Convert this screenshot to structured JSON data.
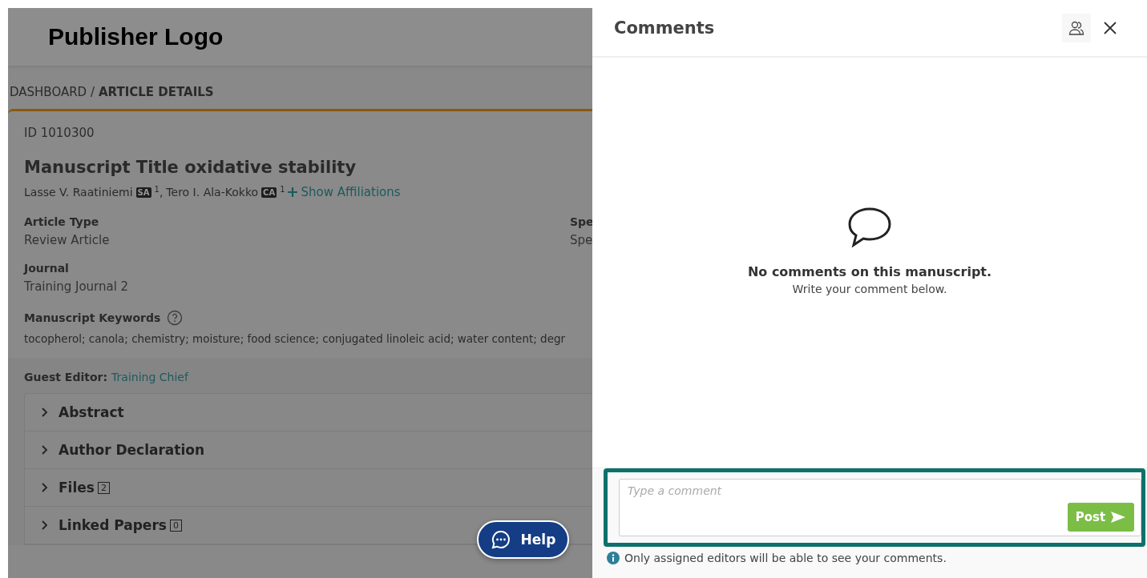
{
  "header": {
    "logo": "Publisher Logo"
  },
  "breadcrumb": {
    "parent": "DASHBOARD /",
    "current": "ARTICLE DETAILS"
  },
  "article": {
    "id": "ID 1010300",
    "title": "Manuscript Title oxidative stability",
    "authors": [
      {
        "name": "Lasse V. Raatiniemi",
        "role": "SA",
        "affiliation": "1",
        "separator": ","
      },
      {
        "name": "Tero I. Ala-Kokko",
        "role": "CA",
        "affiliation": "1"
      }
    ],
    "show_affiliations": "Show Affiliations",
    "fields": [
      {
        "label": "Article Type",
        "value": "Review Article"
      },
      {
        "label": "Journal",
        "value": "Training Journal 2"
      }
    ],
    "side_field": {
      "label": "Spe",
      "value": "Spe"
    },
    "keywords": {
      "label": "Manuscript Keywords",
      "value": "tocopherol; canola; chemistry; moisture; food science; conjugated linoleic acid; water content; degr"
    },
    "guest_editor": {
      "label": "Guest Editor:",
      "name": "Training Chief"
    },
    "sections": [
      {
        "title": "Abstract",
        "expanded": false
      },
      {
        "title": "Author Declaration",
        "expanded": false
      },
      {
        "title": "Files",
        "count": "2",
        "expanded": false
      },
      {
        "title": "Linked Papers",
        "count": "0",
        "expanded": false
      }
    ]
  },
  "help_button": "Help",
  "comments_panel": {
    "title": "Comments",
    "empty_title": "No comments on this manuscript.",
    "empty_hint": "Write your comment below.",
    "placeholder": "Type a comment",
    "post_button": "Post",
    "notice": "Only assigned editors will be able to see your comments."
  }
}
